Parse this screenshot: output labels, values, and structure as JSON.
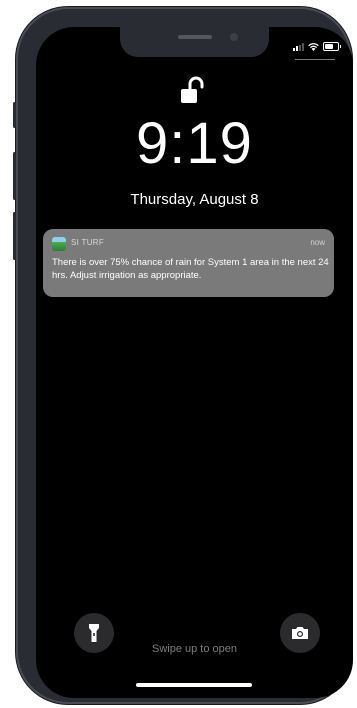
{
  "lockscreen": {
    "time": "9:19",
    "date": "Thursday, August 8",
    "swipe_hint": "Swipe up to open"
  },
  "notification": {
    "app_name": "SI TURF",
    "time": "now",
    "message": "There is over 75% chance of rain for System 1 area in the next 24 hrs. Adjust irrigation as appropriate."
  },
  "icons": {
    "lock": "unlocked-padlock-icon",
    "flashlight": "flashlight-icon",
    "camera": "camera-icon",
    "signal": "cellular-signal-icon",
    "wifi": "wifi-icon",
    "battery": "battery-icon"
  },
  "colors": {
    "screen_background": "#000000",
    "notification_background": "#7a7a7b",
    "device_frame": "#2a2c33"
  }
}
